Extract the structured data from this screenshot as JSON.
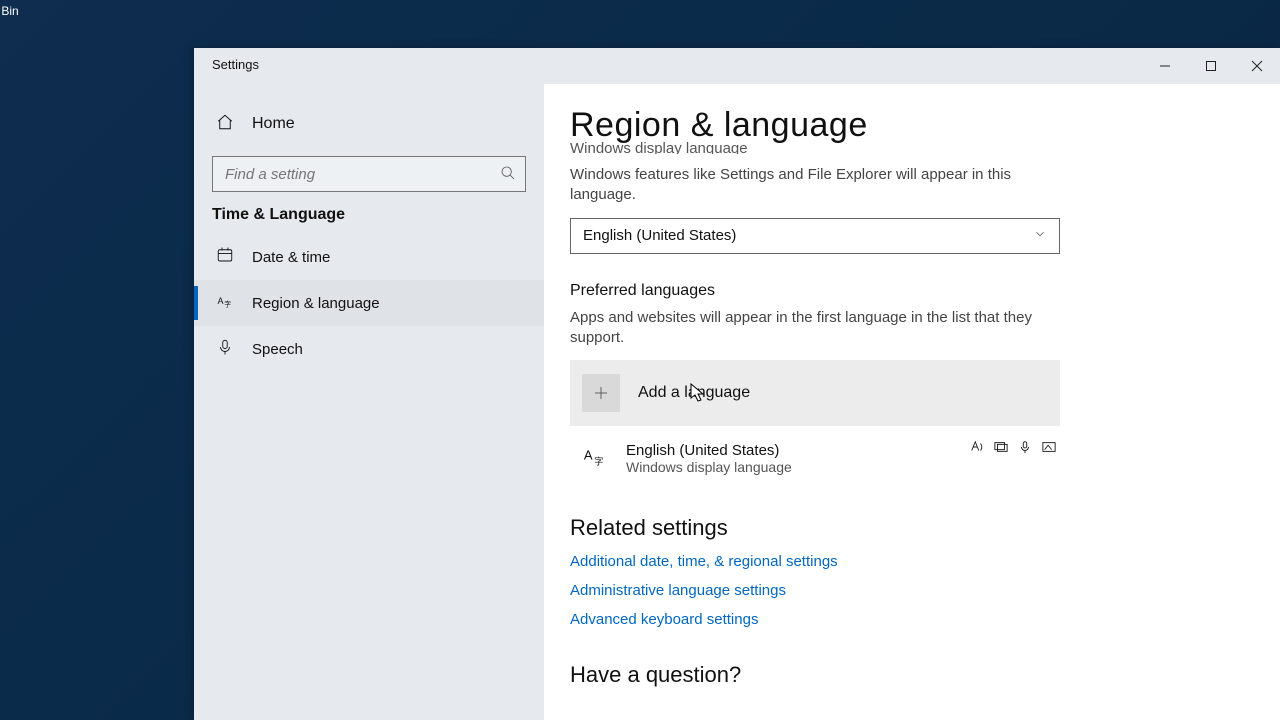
{
  "desktop": {
    "recycle_label": "e Bin"
  },
  "window": {
    "title": "Settings"
  },
  "sidebar": {
    "home": "Home",
    "search_placeholder": "Find a setting",
    "category": "Time & Language",
    "items": [
      {
        "label": "Date & time"
      },
      {
        "label": "Region & language"
      },
      {
        "label": "Speech"
      }
    ],
    "selected_index": 1
  },
  "main": {
    "title": "Region & language",
    "display_lang_header_cut": "Windows display language",
    "display_lang_desc": "Windows features like Settings and File Explorer will appear in this language.",
    "display_lang_selected": "English (United States)",
    "preferred_header": "Preferred languages",
    "preferred_desc": "Apps and websites will appear in the first language in the list that they support.",
    "add_language_label": "Add a language",
    "languages": [
      {
        "name": "English (United States)",
        "sub": "Windows display language"
      }
    ],
    "related_header": "Related settings",
    "related_links": [
      "Additional date, time, & regional settings",
      "Administrative language settings",
      "Advanced keyboard settings"
    ],
    "question_header": "Have a question?"
  }
}
